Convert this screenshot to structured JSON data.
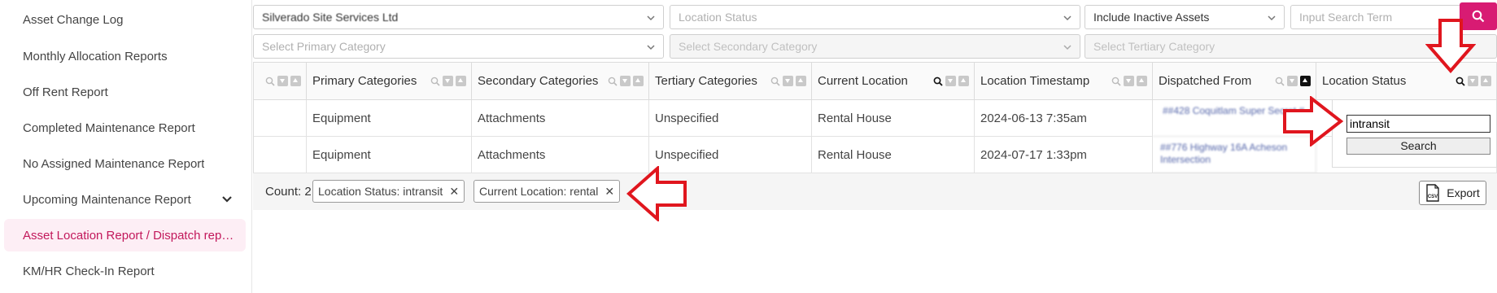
{
  "sidebar": {
    "items": [
      {
        "label": "Asset Change Log"
      },
      {
        "label": "Monthly Allocation Reports"
      },
      {
        "label": "Off Rent Report"
      },
      {
        "label": "Completed Maintenance Report"
      },
      {
        "label": "No Assigned Maintenance Report"
      },
      {
        "label": "Upcoming Maintenance Report"
      },
      {
        "label": "Asset Location Report / Dispatch repo..."
      },
      {
        "label": "KM/HR Check-In Report"
      }
    ]
  },
  "filters": {
    "company": "Silverado Site Services Ltd",
    "location_status_placeholder": "Location Status",
    "inactive": "Include Inactive Assets",
    "search_placeholder": "Input Search Term",
    "primary_placeholder": "Select Primary Category",
    "secondary_placeholder": "Select Secondary Category",
    "tertiary_placeholder": "Select Tertiary Category"
  },
  "table": {
    "headers": [
      "Primary Categories",
      "Secondary Categories",
      "Tertiary Categories",
      "Current Location",
      "Location Timestamp",
      "Dispatched From",
      "Location Status"
    ],
    "rows": [
      {
        "primary": "Equipment",
        "secondary": "Attachments",
        "tertiary": "Unspecified",
        "location": "Rental House",
        "timestamp": "2024-06-13 7:35am",
        "dispatched": "##428 Coquitlam Super Secret #"
      },
      {
        "primary": "Equipment",
        "secondary": "Attachments",
        "tertiary": "Unspecified",
        "location": "Rental House",
        "timestamp": "2024-07-17 1:33pm",
        "dispatched": "##776 Highway 16A Acheson Intersection"
      }
    ]
  },
  "column_filter": {
    "value": "intransit",
    "button": "Search"
  },
  "footer": {
    "count": "Count: 2",
    "chips": [
      {
        "label": "Location Status: intransit"
      },
      {
        "label": "Current Location: rental"
      }
    ],
    "export": "Export",
    "csv": "CSV"
  },
  "colors": {
    "accent": "#d81b73",
    "arrow": "#e0161e"
  }
}
